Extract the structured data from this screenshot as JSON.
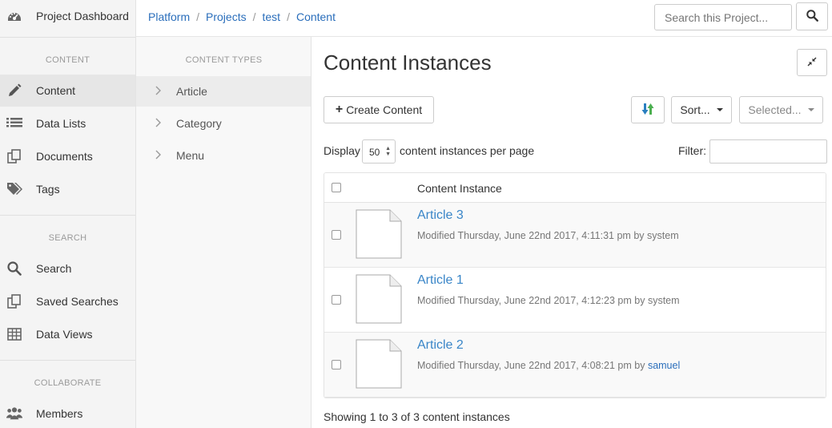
{
  "nav": {
    "dashboard": "Project Dashboard",
    "sections": [
      {
        "heading": "CONTENT",
        "items": [
          "Content",
          "Data Lists",
          "Documents",
          "Tags"
        ]
      },
      {
        "heading": "SEARCH",
        "items": [
          "Search",
          "Saved Searches",
          "Data Views"
        ]
      },
      {
        "heading": "COLLABORATE",
        "items": [
          "Members"
        ]
      }
    ],
    "active_item": "Content"
  },
  "content_types": {
    "heading": "CONTENT TYPES",
    "items": [
      "Article",
      "Category",
      "Menu"
    ],
    "active": "Article"
  },
  "breadcrumb": [
    "Platform",
    "Projects",
    "test",
    "Content"
  ],
  "search": {
    "placeholder": "Search this Project..."
  },
  "main": {
    "title": "Content Instances",
    "create_label": "Create Content",
    "sort_label": "Sort...",
    "selected_label": "Selected...",
    "display_label": "Display",
    "page_size": "50",
    "per_page_label": "content instances per page",
    "filter_label": "Filter:",
    "column_header": "Content Instance",
    "rows": [
      {
        "title": "Article 3",
        "modified": "Modified Thursday, June 22nd 2017, 4:11:31 pm by",
        "user": "system",
        "user_link": false
      },
      {
        "title": "Article 1",
        "modified": "Modified Thursday, June 22nd 2017, 4:12:23 pm by",
        "user": "system",
        "user_link": false
      },
      {
        "title": "Article 2",
        "modified": "Modified Thursday, June 22nd 2017, 4:08:21 pm by",
        "user": "samuel",
        "user_link": true
      }
    ],
    "showing": "Showing 1 to 3 of 3 content instances"
  },
  "colors": {
    "link": "#2a6ebb",
    "sidebar_bg": "#f4f4f4",
    "active_bg": "#e6e6e6"
  }
}
